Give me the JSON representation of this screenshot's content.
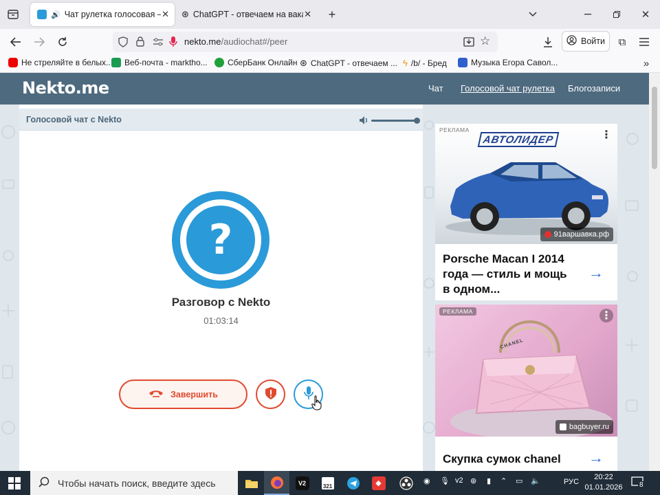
{
  "browser": {
    "tabs": [
      {
        "title": "Чат рулетка голосовая — Не",
        "active": true
      },
      {
        "title": "ChatGPT - отвечаем на ваканс",
        "active": false
      }
    ],
    "url_domain": "nekto.me",
    "url_path": "/audiochat#/peer",
    "login_label": "Войти",
    "bookmarks": [
      "Не стреляйте в белых...",
      "Веб-почта - markthо...",
      "СберБанк Онлайн",
      "ChatGPT - отвечаем ...",
      "/b/ - Бред",
      "Музыка Егора Савол..."
    ]
  },
  "site": {
    "logo": "Nekto.me",
    "nav": [
      "Чат",
      "Голосовой чат рулетка",
      "Блогозаписи"
    ],
    "active_nav": "Голосовой чат рулетка"
  },
  "chat": {
    "header_title": "Голосовой чат с Nekto",
    "avatar_symbol": "?",
    "conversation_title": "Разговор с Nekto",
    "timer": "01:03:14",
    "end_label": "Завершить",
    "volume_level": 1.0
  },
  "ads": [
    {
      "label": "РЕКЛАМА",
      "brand": "АВТОЛИДЕР",
      "source": "91варшавка.рф",
      "text": "Porsche Macan I 2014 года — стиль и мощь в одном..."
    },
    {
      "label": "РЕКЛАМА",
      "bag_brand": "CHANEL",
      "source": "bagbuyer.ru",
      "text": "Скупка сумок chanel"
    }
  ],
  "taskbar": {
    "search_placeholder": "Чтобы начать поиск, введите здесь",
    "language": "РУС",
    "time": "20:22",
    "date": "01.01.2026",
    "notification_count": "8",
    "apps": [
      "file-explorer",
      "firefox",
      "v2",
      "calendar",
      "telegram",
      "anydesk",
      "obs"
    ]
  },
  "colors": {
    "site_header": "#4e6a7f",
    "accent_blue": "#2b9ad8",
    "end_red": "#e04a2f",
    "link_blue": "#2a6fd6"
  }
}
